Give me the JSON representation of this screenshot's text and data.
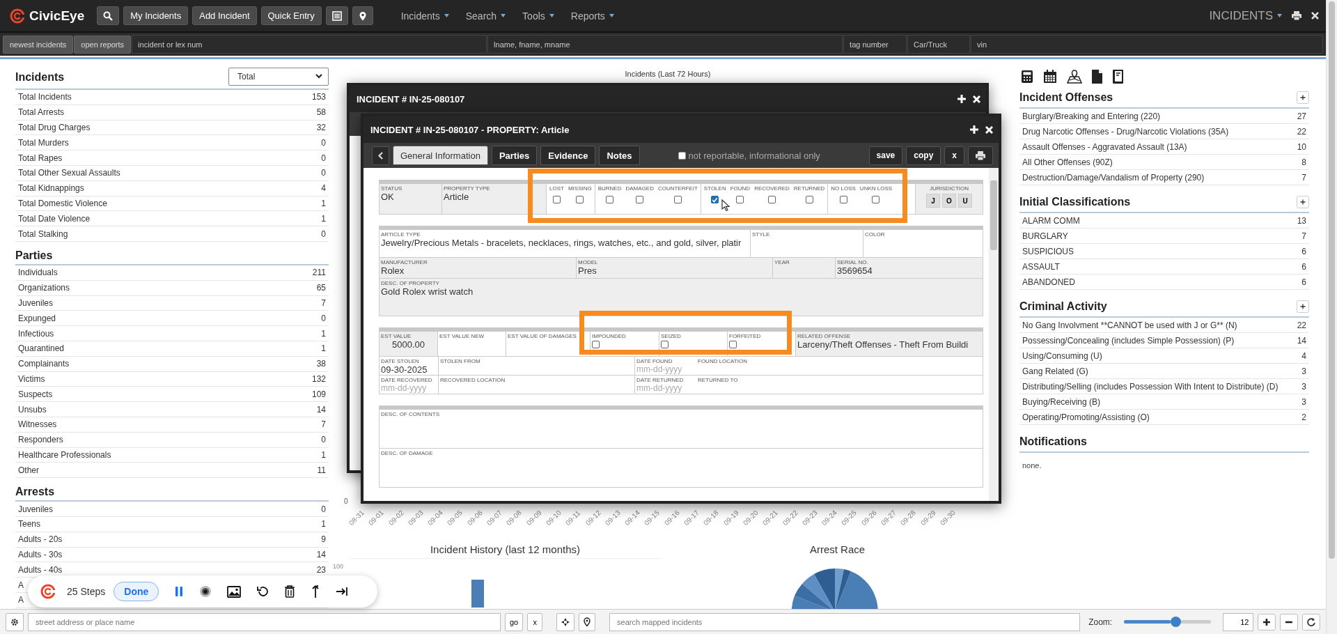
{
  "topbar": {
    "brand": "CivicEye",
    "buttons": [
      {
        "kind": "search"
      },
      {
        "kind": "text",
        "label": "My Incidents"
      },
      {
        "kind": "text",
        "label": "Add Incident"
      },
      {
        "kind": "text",
        "label": "Quick Entry"
      },
      {
        "kind": "list"
      },
      {
        "kind": "pin"
      }
    ],
    "menus": [
      "Incidents",
      "Search",
      "Tools",
      "Reports"
    ],
    "module": "INCIDENTS"
  },
  "quick_search": {
    "buttons": [
      "newest incidents",
      "open reports"
    ],
    "fields": [
      {
        "placeholder": "incident or lex num"
      },
      {
        "placeholder": "lname, fname, mname"
      },
      {
        "placeholder": "tag number"
      },
      {
        "placeholder": "Car/Truck"
      },
      {
        "placeholder": "vin"
      }
    ]
  },
  "left_panel": {
    "filter": "Total",
    "sections": [
      {
        "title": "Incidents",
        "rows": [
          {
            "label": "Total Incidents",
            "count": "153"
          },
          {
            "label": "Total Arrests",
            "count": "58"
          },
          {
            "label": "Total Drug Charges",
            "count": "32"
          },
          {
            "label": "Total Murders",
            "count": "0"
          },
          {
            "label": "Total Rapes",
            "count": "0"
          },
          {
            "label": "Total Other Sexual Assaults",
            "count": "0"
          },
          {
            "label": "Total Kidnappings",
            "count": "4"
          },
          {
            "label": "Total Domestic Violence",
            "count": "1"
          },
          {
            "label": "Total Date Violence",
            "count": "1"
          },
          {
            "label": "Total Stalking",
            "count": "0"
          }
        ]
      },
      {
        "title": "Parties",
        "rows": [
          {
            "label": "Individuals",
            "count": "211"
          },
          {
            "label": "Organizations",
            "count": "65"
          },
          {
            "label": "Juveniles",
            "count": "7"
          },
          {
            "label": "Expunged",
            "count": "0"
          },
          {
            "label": "Infectious",
            "count": "1"
          },
          {
            "label": "Quarantined",
            "count": "1"
          },
          {
            "label": "Complainants",
            "count": "38"
          },
          {
            "label": "Victims",
            "count": "132"
          },
          {
            "label": "Suspects",
            "count": "109"
          },
          {
            "label": "Unsubs",
            "count": "14"
          },
          {
            "label": "Witnesses",
            "count": "7"
          },
          {
            "label": "Responders",
            "count": "0"
          },
          {
            "label": "Healthcare Professionals",
            "count": "1"
          },
          {
            "label": "Other",
            "count": "11"
          }
        ]
      },
      {
        "title": "Arrests",
        "rows": [
          {
            "label": "Juveniles",
            "count": "0"
          },
          {
            "label": "Teens",
            "count": "1"
          },
          {
            "label": "Adults - 20s",
            "count": "9"
          },
          {
            "label": "Adults - 30s",
            "count": "14"
          },
          {
            "label": "Adults - 40s",
            "count": "23"
          },
          {
            "label": "A"
          },
          {
            "label": "A"
          }
        ]
      }
    ]
  },
  "incidents_chart": {
    "title": "Incidents (Last 72 Hours)",
    "y_tick": "0",
    "x_labels": [
      "08-31",
      "09-01",
      "09-02",
      "09-03",
      "09-04",
      "09-05",
      "09-06",
      "09-07",
      "09-08",
      "09-09",
      "09-10",
      "09-11",
      "09-12",
      "09-13",
      "09-14",
      "09-15",
      "09-16",
      "09-17",
      "09-18",
      "09-19",
      "09-20",
      "09-21",
      "09-22",
      "09-23",
      "09-24",
      "09-25",
      "09-26",
      "09-27",
      "09-28",
      "09-29",
      "09-30"
    ]
  },
  "history_chart": {
    "title": "Incident History (last 12 months)",
    "y_tick": "100"
  },
  "race_chart": {
    "title": "Arrest Race"
  },
  "right_panel": {
    "sections": [
      {
        "title": "Incident Offenses",
        "rows": [
          {
            "label": "Burglary/Breaking and Entering (220)",
            "count": "27"
          },
          {
            "label": "Drug Narcotic Offenses - Drug/Narcotic Violations (35A)",
            "count": "22"
          },
          {
            "label": "Assault Offenses - Aggravated Assault (13A)",
            "count": "10"
          },
          {
            "label": "All Other Offenses (90Z)",
            "count": "8"
          },
          {
            "label": "Destruction/Damage/Vandalism of Property (290)",
            "count": "7"
          }
        ]
      },
      {
        "title": "Initial Classifications",
        "rows": [
          {
            "label": "ALARM COMM",
            "count": "13"
          },
          {
            "label": "BURGLARY",
            "count": "7"
          },
          {
            "label": "SUSPICIOUS",
            "count": "6"
          },
          {
            "label": "ASSAULT",
            "count": "6"
          },
          {
            "label": "ABANDONED",
            "count": "6"
          }
        ]
      },
      {
        "title": "Criminal Activity",
        "rows": [
          {
            "label": "No Gang Involvment **CANNOT be used with J or G** (N)",
            "count": "22"
          },
          {
            "label": "Possessing/Concealing (includes Simple Possession) (P)",
            "count": "14"
          },
          {
            "label": "Using/Consuming (U)",
            "count": "4"
          },
          {
            "label": "Gang Related (G)",
            "count": "3"
          },
          {
            "label": "Distributing/Selling (includes Possession With Intent to Distribute) (D)",
            "count": "3"
          },
          {
            "label": "Buying/Receiving (B)",
            "count": "3"
          },
          {
            "label": "Operating/Promoting/Assisting (O)",
            "count": "2"
          }
        ]
      },
      {
        "title": "Notifications",
        "note": "none."
      }
    ]
  },
  "incident_window": {
    "title": "INCIDENT # IN-25-080107"
  },
  "property_window": {
    "title": "INCIDENT # IN-25-080107 - PROPERTY: Article",
    "tabs": [
      {
        "label": "General Information",
        "selected": true
      },
      {
        "label": "Parties",
        "selected": false
      },
      {
        "label": "Evidence",
        "selected": false
      },
      {
        "label": "Notes",
        "selected": false
      }
    ],
    "informational": {
      "label": "not reportable, informational only",
      "checked": false
    },
    "actions": [
      "save",
      "copy",
      "x"
    ],
    "sections": [
      {
        "rows": [
          [
            {
              "kind": "text",
              "label": "STATUS",
              "value": "OK"
            },
            {
              "kind": "text",
              "label": "PROPERTY TYPE",
              "value": "Article"
            },
            {
              "kind": "flags",
              "groups": [
                [
                  {
                    "label": "LOST",
                    "checked": false
                  },
                  {
                    "label": "MISSING",
                    "checked": false
                  }
                ],
                [
                  {
                    "label": "BURNED",
                    "checked": false
                  },
                  {
                    "label": "DAMAGED",
                    "checked": false
                  },
                  {
                    "label": "COUNTERFEIT",
                    "checked": false
                  }
                ],
                [
                  {
                    "label": "STOLEN",
                    "checked": true
                  },
                  {
                    "label": "FOUND",
                    "checked": false
                  },
                  {
                    "label": "RECOVERED",
                    "checked": false
                  },
                  {
                    "label": "RETURNED",
                    "checked": false
                  }
                ],
                [
                  {
                    "label": "NO LOSS",
                    "checked": false
                  },
                  {
                    "label": "UNKN LOSS",
                    "checked": false
                  }
                ]
              ]
            },
            {
              "kind": "buttons",
              "label": "JURISDICTION",
              "buttons": [
                "J",
                "O",
                "U"
              ]
            }
          ]
        ]
      },
      {
        "rows": [
          [
            {
              "kind": "text",
              "label": "ARTICLE TYPE",
              "value": "Jewelry/Precious Metals - bracelets, necklaces, rings, watches, etc., and gold, silver, platir"
            },
            {
              "kind": "text",
              "label": "STYLE"
            },
            {
              "kind": "text",
              "label": "COLOR"
            }
          ],
          [
            {
              "kind": "text",
              "label": "MANUFACTURER",
              "value": "Rolex"
            },
            {
              "kind": "text",
              "label": "MODEL",
              "value": "Pres"
            },
            {
              "kind": "text",
              "label": "YEAR"
            },
            {
              "kind": "text",
              "label": "SERIAL NO.",
              "value": "3569654"
            }
          ],
          [
            {
              "kind": "area",
              "label": "DESC. OF PROPERTY",
              "value": "Gold Rolex wrist watch"
            }
          ]
        ]
      },
      {
        "rows": [
          [
            {
              "kind": "text",
              "label": "EST VALUE",
              "value": "5000.00"
            },
            {
              "kind": "text",
              "label": "EST VALUE NEW"
            },
            {
              "kind": "text",
              "label": "EST VALUE OF DAMAGES"
            },
            {
              "kind": "check",
              "label": "IMPOUNDED",
              "checked": false
            },
            {
              "kind": "check",
              "label": "SEIZED",
              "checked": false
            },
            {
              "kind": "check",
              "label": "FORFEITED",
              "checked": false
            },
            {
              "kind": "text",
              "label": "RELATED OFFENSE",
              "value": "Larceny/Theft Offenses - Theft From Buildi"
            }
          ],
          [
            {
              "kind": "text",
              "label": "DATE STOLEN",
              "value": "09-30-2025"
            },
            {
              "kind": "text",
              "label": "STOLEN FROM"
            },
            {
              "kind": "text",
              "label": "DATE FOUND",
              "placeholder": "mm-dd-yyyy"
            },
            {
              "kind": "text",
              "label": "FOUND LOCATION"
            }
          ],
          [
            {
              "kind": "text",
              "label": "DATE RECOVERED",
              "placeholder": "mm-dd-yyyy"
            },
            {
              "kind": "text",
              "label": "RECOVERED LOCATION"
            },
            {
              "kind": "text",
              "label": "DATE RETURNED",
              "placeholder": "mm-dd-yyyy"
            },
            {
              "kind": "text",
              "label": "RETURNED TO"
            }
          ]
        ]
      },
      {
        "rows": [
          [
            {
              "kind": "area",
              "label": "DESC. OF CONTENTS"
            }
          ],
          [
            {
              "kind": "area",
              "label": "DESC. OF DAMAGE"
            }
          ]
        ]
      }
    ]
  },
  "map_bar": {
    "address_placeholder": "street address or place name",
    "buttons": [
      "go",
      "x"
    ],
    "search_placeholder": "search mapped incidents",
    "zoom_label": "Zoom:",
    "zoom": {
      "level": 0.53
    },
    "zoom_value": "12"
  },
  "recorder": {
    "steps": "25 Steps",
    "done": "Done"
  }
}
